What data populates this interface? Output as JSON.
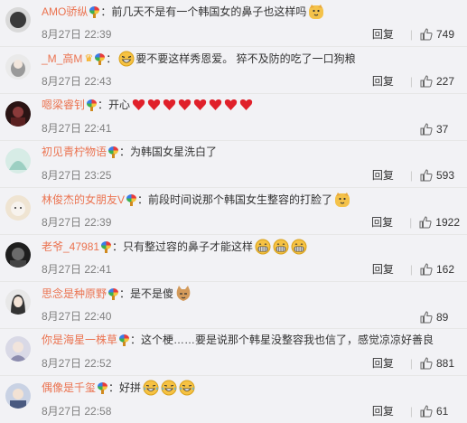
{
  "reply_label": "回复",
  "colors": {
    "username": "#eb7350",
    "timestamp": "#808080",
    "background": "#f2f2f5"
  },
  "comments": [
    {
      "user": "AMO骄纵",
      "text": "：前几天不是有一个韩国女的鼻子也这样吗",
      "emojis": [
        "doge-emoji"
      ],
      "time": "8月27日 22:39",
      "likes": "749",
      "avatar_color": "#3a3a3a"
    },
    {
      "user": "_M_高M",
      "text": "要不要这样秀恩爱。 猝不及防的吃了一口狗粮",
      "emojis_before_text": [
        "laughing-emoji"
      ],
      "time": "8月27日 22:43",
      "likes": "227",
      "avatar_color": "#d8d8d8"
    },
    {
      "user": "嗯梁睿钊",
      "text": "：开心",
      "emojis": [
        "heart",
        "heart",
        "heart",
        "heart",
        "heart",
        "heart",
        "heart",
        "heart"
      ],
      "time": "8月27日 22:41",
      "likes": "37",
      "avatar_color": "#5a2020"
    },
    {
      "user": "初见青柠物语",
      "text": "：为韩国女星洗白了",
      "emojis": [],
      "time": "8月27日 23:25",
      "likes": "593",
      "avatar_color": "#cfe3de"
    },
    {
      "user": "林俊杰的女朋友V",
      "text": "：前段时间说那个韩国女生整容的打脸了",
      "emojis": [
        "doge-emoji"
      ],
      "time": "8月27日 22:39",
      "likes": "1922",
      "avatar_color": "#e9dcc8"
    },
    {
      "user": "老爷_47981",
      "text": "：只有整过容的鼻子才能这样",
      "emojis": [
        "grin-emoji",
        "grin-emoji",
        "grin-emoji"
      ],
      "time": "8月27日 22:41",
      "likes": "162",
      "avatar_color": "#2a2a2a"
    },
    {
      "user": "思念是种原野",
      "text": "：是不是傻",
      "emojis": [
        "cat-emoji"
      ],
      "time": "8月27日 22:40",
      "likes": "89",
      "avatar_color": "#444"
    },
    {
      "user": "你是海星一株草",
      "text": "：这个梗……要是说那个韩星没整容我也信了，感觉凉凉好善良",
      "emojis": [],
      "time": "8月27日 22:52",
      "likes": "881",
      "avatar_color": "#b9b9c9"
    },
    {
      "user": "偶像是千玺",
      "text": "：好拼",
      "emojis": [
        "tears-emoji",
        "tears-emoji",
        "tears-emoji"
      ],
      "time": "8月27日 22:58",
      "likes": "61",
      "avatar_color": "#6a7aa0"
    }
  ]
}
